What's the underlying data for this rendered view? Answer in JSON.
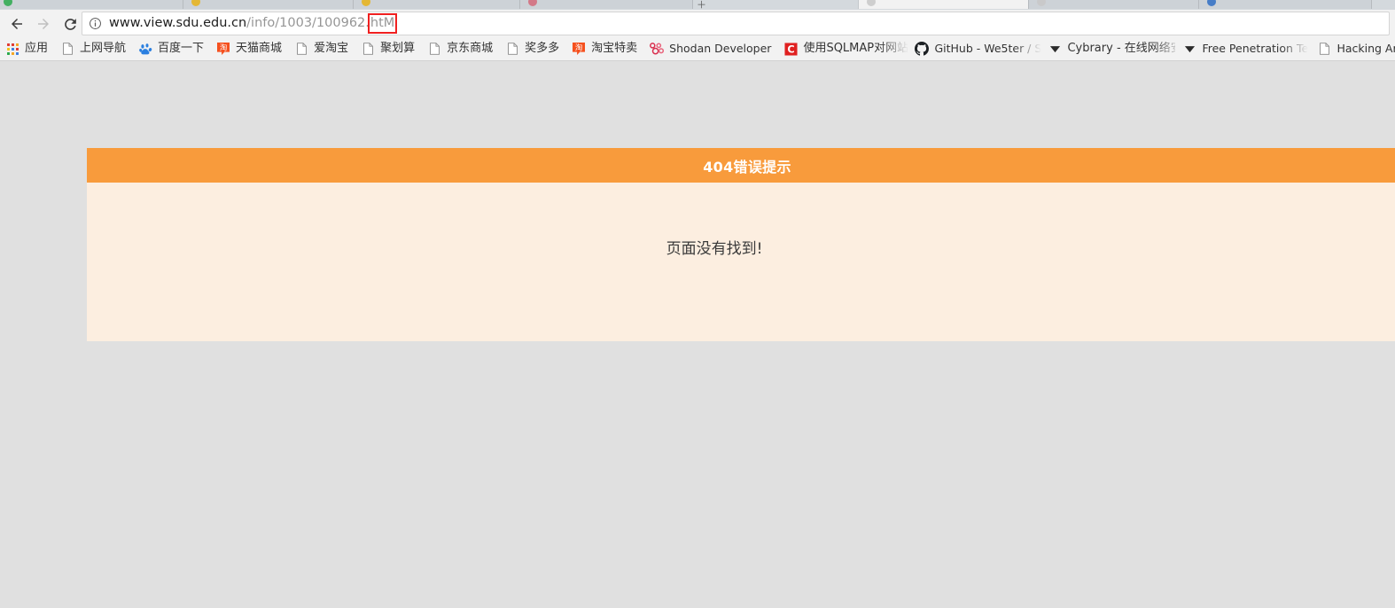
{
  "browser": {
    "nav": {
      "back_label": "Back",
      "forward_label": "Forward",
      "reload_label": "Reload this page"
    },
    "omnibox": {
      "site_info_icon": "info-circle-icon",
      "url_host": "www.view.sdu.edu.cn",
      "url_path": "/info/1003/100962.",
      "url_highlighted": "htM",
      "full_url": "www.view.sdu.edu.cn/info/1003/100962.htM",
      "highlight_color": "#f02020"
    },
    "tabs": [
      {
        "favicon_color": "#2aa94c"
      },
      {
        "favicon_color": "#e8b317"
      },
      {
        "favicon_color": "#e8b317"
      },
      {
        "favicon_color": "#d46a7a"
      },
      {
        "favicon_color": "#bdbdbd"
      },
      {
        "favicon_color": "#bdbdbd"
      },
      {
        "favicon_color": "#2f6fc4"
      },
      {
        "favicon_color": "#bdbdbd"
      }
    ],
    "new_tab_label": "＋",
    "bookmarks": [
      {
        "label": "应用",
        "icon": "apps-grid-icon",
        "lang": "cn"
      },
      {
        "label": "上网导航",
        "icon": "document-icon",
        "lang": "cn"
      },
      {
        "label": "百度一下",
        "icon": "baidu-paw-icon",
        "lang": "cn"
      },
      {
        "label": "天猫商城",
        "icon": "taobao-tao-icon",
        "lang": "cn"
      },
      {
        "label": "爱淘宝",
        "icon": "document-icon",
        "lang": "cn"
      },
      {
        "label": "聚划算",
        "icon": "document-icon",
        "lang": "cn"
      },
      {
        "label": "京东商城",
        "icon": "document-icon",
        "lang": "cn"
      },
      {
        "label": "奖多多",
        "icon": "document-icon",
        "lang": "cn"
      },
      {
        "label": "淘宝特卖",
        "icon": "taobao-tao-icon",
        "lang": "cn"
      },
      {
        "label": "Shodan Developer",
        "icon": "shodan-icon",
        "lang": "en"
      },
      {
        "label": "使用SQLMAP对网站",
        "icon": "sqlmap-c-icon",
        "lang": "cn",
        "truncated": true
      },
      {
        "label": "GitHub - We5ter / S",
        "icon": "github-icon",
        "lang": "en",
        "truncated": true
      },
      {
        "label": "Cybrary - 在线网络安",
        "icon": "chevron-down-icon",
        "lang": "cn",
        "truncated": true
      },
      {
        "label": "Free Penetration Te",
        "icon": "chevron-down-icon",
        "lang": "en",
        "truncated": true
      },
      {
        "label": "Hacking Articles a",
        "icon": "document-icon",
        "lang": "en",
        "truncated": true
      }
    ]
  },
  "page": {
    "background_color": "#e0e0e0",
    "error": {
      "header_title": "404错误提示",
      "header_color": "#f89b3c",
      "body_color": "#fceee0",
      "message": "页面没有找到!"
    }
  }
}
